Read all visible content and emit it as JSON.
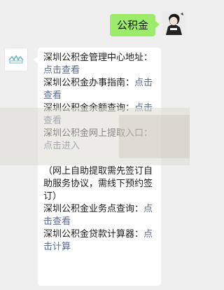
{
  "chat": {
    "outgoing": {
      "text": "公积金"
    },
    "incoming": {
      "lines": [
        {
          "label": "深圳公积金管理中心地址：",
          "link": "点击查看"
        },
        {
          "label": "深圳公积金办事指南：",
          "link": "点击查看"
        },
        {
          "label": "深圳公积金余额查询：",
          "link": "点击查看"
        },
        {
          "label": "深圳公积金网上提取入口：",
          "link": "点击进入"
        },
        {
          "note": "（网上自助提取需先签订自助服务协议，需线下预约签订）"
        },
        {
          "label": "深圳公积金业务点查询：",
          "link": "点击查看"
        },
        {
          "label": "深圳公积金贷款计算器：",
          "link": "点击计算"
        }
      ]
    }
  },
  "icons": {
    "bot_avatar": "housing-fund-logo",
    "user_avatar": "user-avatar-illustration"
  },
  "colors": {
    "background": "#efefef",
    "outgoing_bubble": "#9ceb6a",
    "incoming_bubble": "#ffffff",
    "link": "#586c94",
    "logo": "#6cb8c8"
  }
}
